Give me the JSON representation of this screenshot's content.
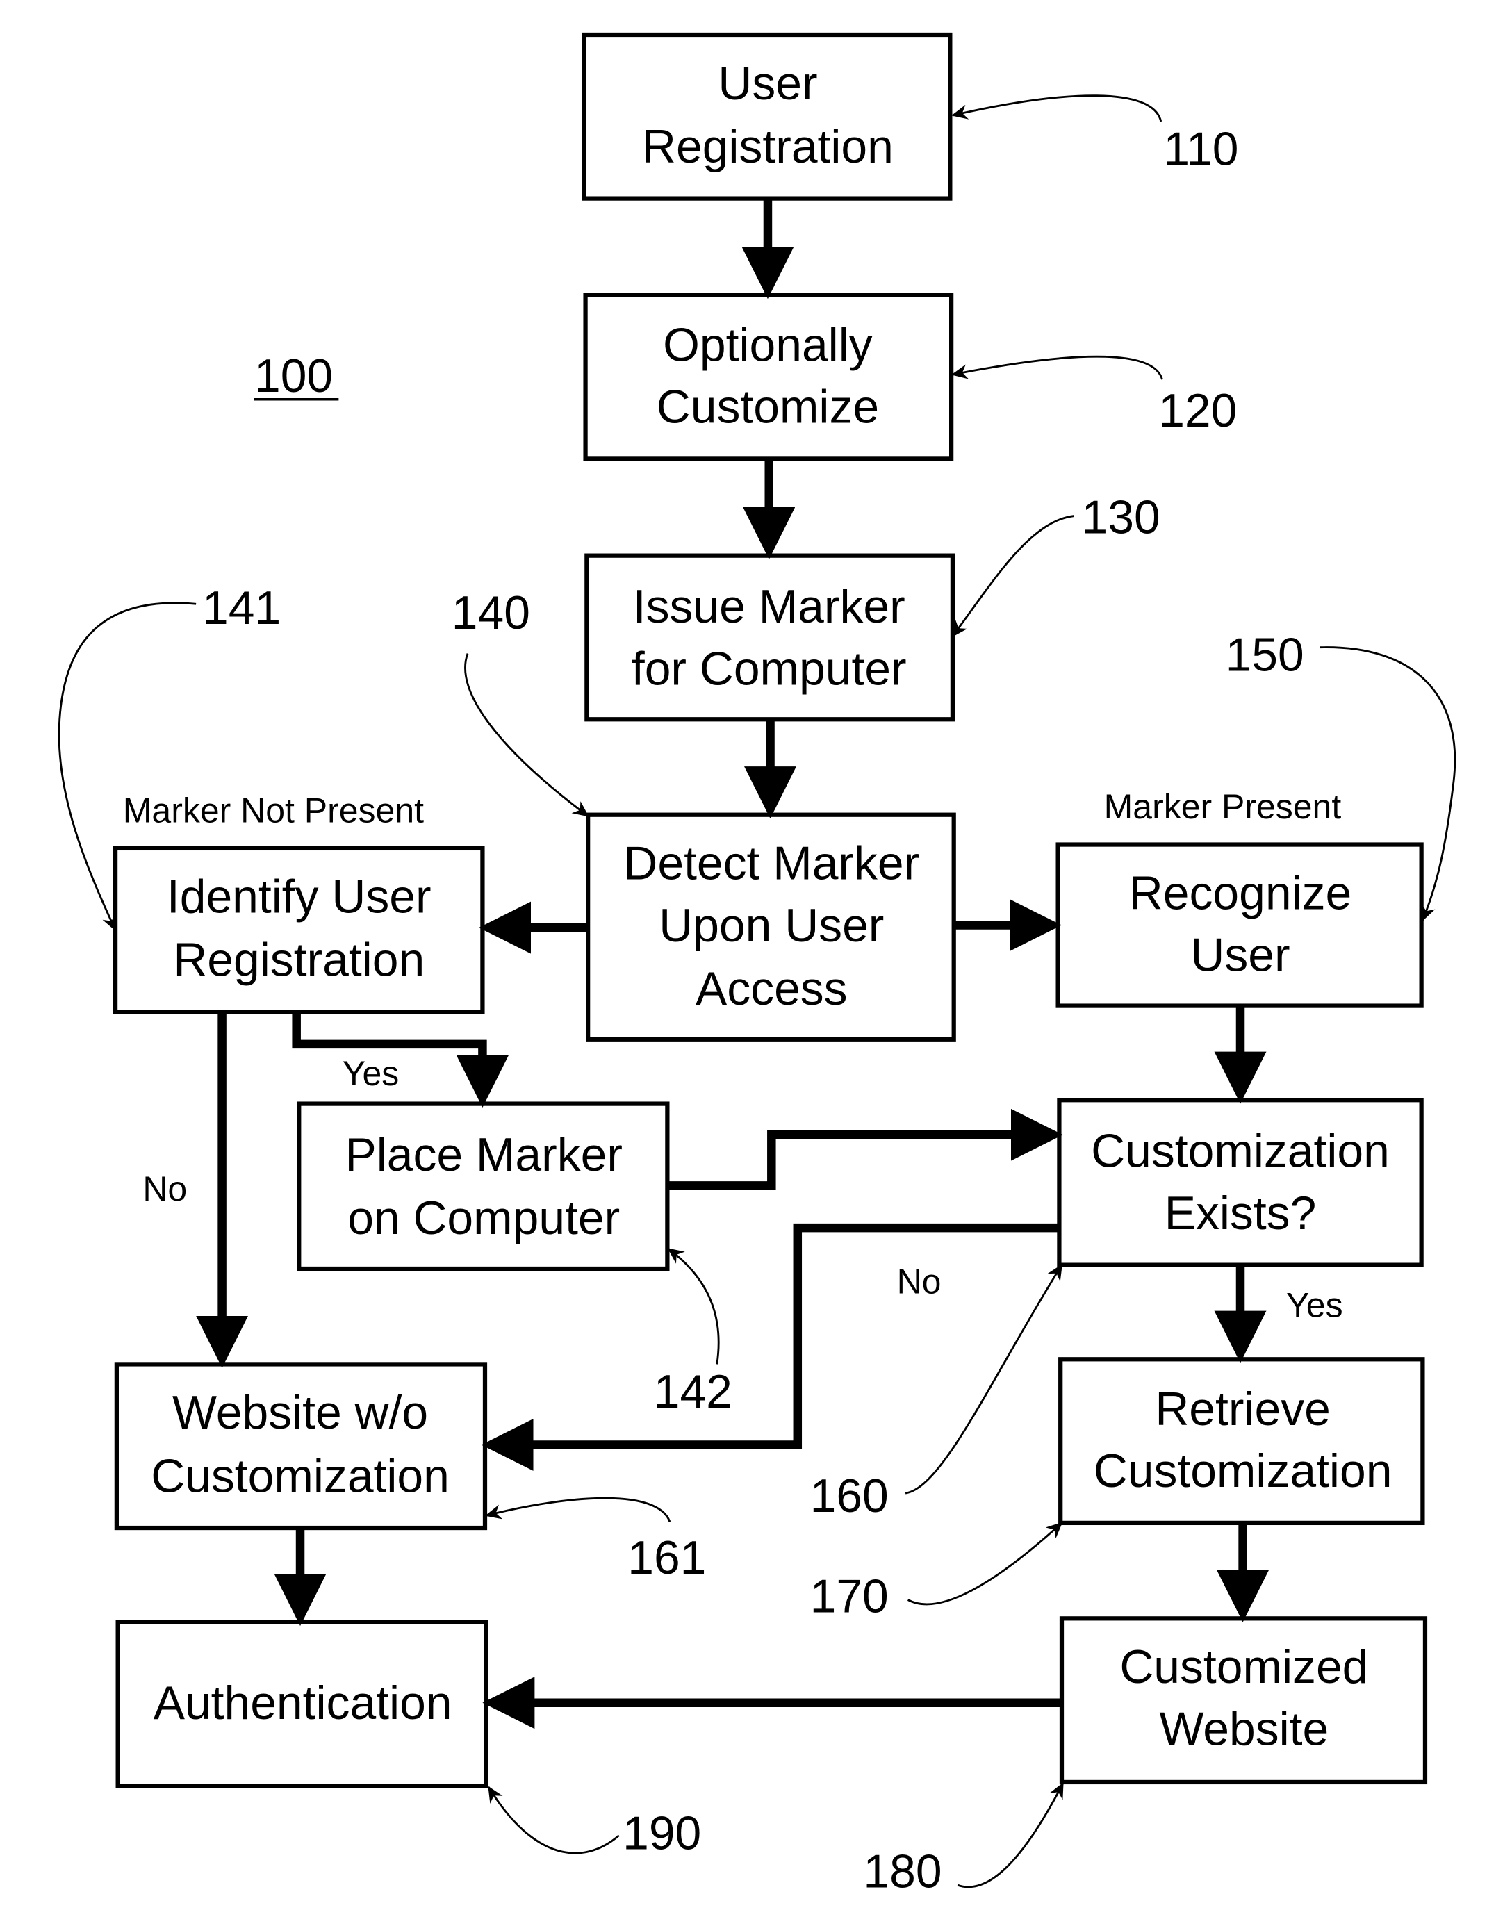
{
  "figure": {
    "number": "100",
    "colors": {
      "stroke": "#000000",
      "background": "#ffffff"
    }
  },
  "boxes": {
    "b110": {
      "ref": "110",
      "lines": [
        "User",
        "Registration"
      ]
    },
    "b120": {
      "ref": "120",
      "lines": [
        "Optionally",
        "Customize"
      ]
    },
    "b130": {
      "ref": "130",
      "lines": [
        "Issue Marker",
        "for Computer"
      ]
    },
    "b140": {
      "ref": "140",
      "lines": [
        "Detect Marker",
        "Upon User",
        "Access"
      ]
    },
    "b141": {
      "ref": "141",
      "lines": [
        "Identify User",
        "Registration"
      ]
    },
    "b142": {
      "ref": "142",
      "lines": [
        "Place Marker",
        "on Computer"
      ]
    },
    "b150": {
      "ref": "150",
      "lines": [
        "Recognize",
        "User"
      ]
    },
    "b160": {
      "ref": "160",
      "lines": [
        "Customization",
        "Exists?"
      ]
    },
    "b161": {
      "ref": "161",
      "lines": [
        "Website w/o",
        "Customization"
      ]
    },
    "b170": {
      "ref": "170",
      "lines": [
        "Retrieve",
        "Customization"
      ]
    },
    "b180": {
      "ref": "180",
      "lines": [
        "Customized",
        "Website"
      ]
    },
    "b190": {
      "ref": "190",
      "lines": [
        "Authentication"
      ]
    }
  },
  "labels": {
    "marker_not_present": "Marker Not Present",
    "marker_present": "Marker Present",
    "yes_place": "Yes",
    "no_website": "No",
    "no_custom": "No",
    "yes_retrieve": "Yes"
  }
}
